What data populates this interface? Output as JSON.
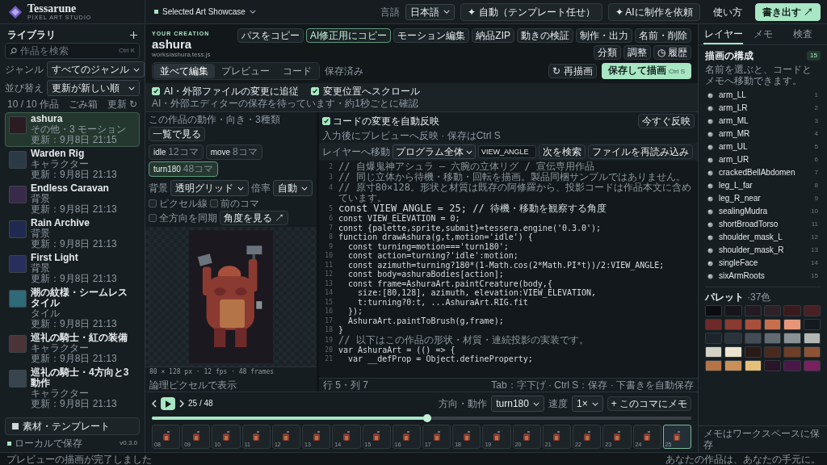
{
  "app": {
    "name": "Tessarune",
    "tagline": "PIXEL ART STUDIO"
  },
  "header": {
    "showcase": "Selected Art Showcase",
    "language_label": "言語",
    "language": "日本語",
    "buttons": [
      {
        "label": "✦ 自動（テンプレート任せ）",
        "kind": "outline"
      },
      {
        "label": "✦ AIに制作を依頼",
        "kind": "outline"
      },
      {
        "label": "使い方",
        "kind": "text"
      },
      {
        "label": "書き出す ↗",
        "kind": "primary"
      }
    ]
  },
  "library": {
    "title": "ライブラリ",
    "search_placeholder": "作品を検索",
    "search_shortcut": "Ctrl K",
    "filters": [
      {
        "label": "ジャンル",
        "value": "すべてのジャンル"
      },
      {
        "label": "並び替え",
        "value": "更新が新しい順"
      }
    ],
    "count": "10 / 10 作品",
    "trash": "ごみ箱",
    "refresh": "更新 ↻",
    "items": [
      {
        "title": "ashura",
        "category": "その他・3 モーション",
        "updated": "更新：9月8日 21:15",
        "selected": true,
        "color": "#2a1c22"
      },
      {
        "title": "Warden Rig",
        "category": "キャラクター",
        "updated": "更新：9月8日 21:13",
        "selected": false,
        "color": "#2c3a46"
      },
      {
        "title": "Endless Caravan",
        "category": "背景",
        "updated": "更新：9月8日 21:13",
        "selected": false,
        "color": "#3a2a4a"
      },
      {
        "title": "Rain Archive",
        "category": "背景",
        "updated": "更新：9月8日 21:13",
        "selected": false,
        "color": "#202a50"
      },
      {
        "title": "First Light",
        "category": "背景",
        "updated": "更新：9月8日 21:13",
        "selected": false,
        "color": "#2a2e5c"
      },
      {
        "title": "潮の紋様・シームレスタイル",
        "category": "タイル",
        "updated": "更新：9月8日 21:13",
        "selected": false,
        "color": "#2e6a78"
      },
      {
        "title": "巡礼の騎士・紅の装備",
        "category": "キャラクター",
        "updated": "更新：9月8日 21:13",
        "selected": false,
        "color": "#4a3438"
      },
      {
        "title": "巡礼の騎士・4方向と3動作",
        "category": "キャラクター",
        "updated": "更新：9月8日 21:13",
        "selected": false,
        "color": "#38444e"
      }
    ],
    "templates_button": "素材・テンプレート",
    "storage": "ローカルで保存",
    "version": "v0.3.0"
  },
  "creation": {
    "eyebrow": "YOUR CREATION",
    "title": "ashura",
    "path": "works/ashura.tess.js",
    "actions": [
      {
        "label": "パスをコピー",
        "kind": "plain"
      },
      {
        "label": "AI修正用にコピー",
        "kind": "accent"
      },
      {
        "label": "モーション編集",
        "kind": "plain"
      },
      {
        "label": "納品ZIP",
        "kind": "plain"
      },
      {
        "label": "動きの検証",
        "kind": "plain"
      },
      {
        "label": "制作・出力",
        "kind": "plain"
      },
      {
        "label": "名前・削除",
        "kind": "plain"
      },
      {
        "label": "分類",
        "kind": "plain"
      },
      {
        "label": "調整",
        "kind": "plain"
      },
      {
        "label": "◷ 履歴",
        "kind": "plain"
      }
    ],
    "view_tabs": [
      {
        "label": "並べて編集",
        "selected": true
      },
      {
        "label": "プレビュー",
        "selected": false
      },
      {
        "label": "コード",
        "selected": false
      }
    ],
    "save_state": "保存済み",
    "redraw": "↻ 再描画",
    "save_button": "保存して描画",
    "save_shortcut": "Ctrl S",
    "options": [
      {
        "label": "AI・外部ファイルの変更に追従",
        "checked": true
      },
      {
        "label": "変更位置へスクロール",
        "checked": true
      }
    ],
    "watch_note": "AI・外部エディターの保存を待っています・約1秒ごとに確認"
  },
  "preview": {
    "heading": "この作品の動作・向き・3種類",
    "overview_button": "一覧で見る",
    "motions": [
      {
        "name": "idle",
        "frames": "12コマ",
        "selected": false
      },
      {
        "name": "move",
        "frames": "8コマ",
        "selected": false
      },
      {
        "name": "turn180",
        "frames": "48コマ",
        "selected": true
      }
    ],
    "background_label": "背景",
    "background": "透明グリッド",
    "zoom_label": "倍率",
    "zoom": "自動",
    "toggles": [
      {
        "label": "ピクセル線",
        "checked": false
      },
      {
        "label": "前のコマ",
        "checked": false
      },
      {
        "label": "全方向を同期",
        "checked": false
      }
    ],
    "angle_button": "角度を見る ↗",
    "info": "80 × 128 px · 12 fps · 48 frames",
    "display_mode": "論理ピクセルで表示"
  },
  "code": {
    "auto_apply": {
      "label": "コードの変更を自動反映",
      "checked": true
    },
    "apply_button": "今すぐ反映",
    "hint": "入力後にプレビューへ反映 · 保存はCtrl S",
    "jump_label": "レイヤーへ移動",
    "jump_target": "プログラム全体",
    "search_value": "VIEW_ANGLE",
    "find_next": "次を検索",
    "reload": "ファイルを再読み込み",
    "lines": [
      {
        "number": "2",
        "text": "// 自爆鬼神アシュラ — 六腕の立体リグ / 宣伝専用作品",
        "kind": "comment"
      },
      {
        "number": "3",
        "text": "// 同じ立体から待機・移動・回転を描画。製品同梱サンプルではありません。",
        "kind": "comment"
      },
      {
        "number": "4",
        "text": "// 原寸80×128。形状と材質は既存の阿修羅から、投影コードは作品本文に含めています。",
        "kind": "comment"
      },
      {
        "number": "5",
        "text": "const VIEW_ANGLE = 25; // 待機・移動を観察する角度",
        "kind": "code"
      },
      {
        "number": "6",
        "text": "const VIEW_ELEVATION = 0;",
        "kind": "code"
      },
      {
        "number": "7",
        "text": "const {palette,sprite,submit}=tessera.engine('0.3.0');",
        "kind": "code"
      },
      {
        "number": "8",
        "text": "function drawAshura(g,t,motion='idle') {",
        "kind": "code"
      },
      {
        "number": "9",
        "text": "  const turning=motion==='turn180';",
        "kind": "code"
      },
      {
        "number": "10",
        "text": "  const action=turning?'idle':motion;",
        "kind": "code"
      },
      {
        "number": "11",
        "text": "  const azimuth=turning?180*(1-Math.cos(2*Math.PI*t))/2:VIEW_ANGLE;",
        "kind": "code"
      },
      {
        "number": "12",
        "text": "  const body=ashuraBodies[action];",
        "kind": "code"
      },
      {
        "number": "13",
        "text": "  const frame=AshuraArt.paintCreature(body,{",
        "kind": "code"
      },
      {
        "number": "14",
        "text": "    size:[80,128], azimuth, elevation:VIEW_ELEVATION,",
        "kind": "code"
      },
      {
        "number": "15",
        "text": "    t:turning?0:t, ...AshuraArt.RIG.fit",
        "kind": "code"
      },
      {
        "number": "16",
        "text": "  });",
        "kind": "code"
      },
      {
        "number": "17",
        "text": "  AshuraArt.paintToBrush(g,frame);",
        "kind": "code"
      },
      {
        "number": "18",
        "text": "}",
        "kind": "code"
      },
      {
        "number": "19",
        "text": "// 以下はこの作品の形状・材質・連続投影の実装です。",
        "kind": "comment"
      },
      {
        "number": "20",
        "text": "var AshuraArt = (() => {",
        "kind": "code"
      },
      {
        "number": "21",
        "text": "  var __defProp = Object.defineProperty;",
        "kind": "code"
      }
    ],
    "cursor": "行 5・列 7",
    "shortcuts": "Tab：字下げ · Ctrl S：保存 · 下書きを自動保存"
  },
  "timeline": {
    "position": "25 / 48",
    "level": 0.51,
    "direction_label": "方向・動作",
    "direction": "turn180",
    "speed_label": "速度",
    "speed": "1×",
    "memo_button": "+ このコマにメモ",
    "frames": [
      {
        "number": "08",
        "selected": false
      },
      {
        "number": "09",
        "selected": false
      },
      {
        "number": "10",
        "selected": false
      },
      {
        "number": "11",
        "selected": false
      },
      {
        "number": "12",
        "selected": false
      },
      {
        "number": "13",
        "selected": false
      },
      {
        "number": "14",
        "selected": false
      },
      {
        "number": "15",
        "selected": false
      },
      {
        "number": "16",
        "selected": false
      },
      {
        "number": "17",
        "selected": false
      },
      {
        "number": "18",
        "selected": false
      },
      {
        "number": "19",
        "selected": false
      },
      {
        "number": "20",
        "selected": false
      },
      {
        "number": "21",
        "selected": false
      },
      {
        "number": "22",
        "selected": false
      },
      {
        "number": "23",
        "selected": false
      },
      {
        "number": "24",
        "selected": false
      },
      {
        "number": "25",
        "selected": true
      }
    ]
  },
  "inspector": {
    "tabs": [
      {
        "label": "レイヤー",
        "selected": true
      },
      {
        "label": "メモ",
        "selected": false
      },
      {
        "label": "検査",
        "selected": false
      }
    ],
    "heading": "描画の構成",
    "count": "15",
    "description": "名前を選ぶと、コードとメモへ移動できます。",
    "layers": [
      {
        "name": "arm_LL",
        "number": "1"
      },
      {
        "name": "arm_LR",
        "number": "2"
      },
      {
        "name": "arm_ML",
        "number": "3"
      },
      {
        "name": "arm_MR",
        "number": "4"
      },
      {
        "name": "arm_UL",
        "number": "5"
      },
      {
        "name": "arm_UR",
        "number": "6"
      },
      {
        "name": "crackedBellAbdomen",
        "number": "7"
      },
      {
        "name": "leg_L_far",
        "number": "8"
      },
      {
        "name": "leg_R_near",
        "number": "9"
      },
      {
        "name": "sealingMudra",
        "number": "10"
      },
      {
        "name": "shortBroadTorso",
        "number": "11"
      },
      {
        "name": "shoulder_mask_L",
        "number": "12"
      },
      {
        "name": "shoulder_mask_R",
        "number": "13"
      },
      {
        "name": "singleFace",
        "number": "14"
      },
      {
        "name": "sixArmRoots",
        "number": "15"
      }
    ],
    "palette": {
      "title": "パレット",
      "count": "·37色",
      "colors": [
        {
          "color": "#0b0d10"
        },
        {
          "color": "#15151b"
        },
        {
          "color": "#241a22"
        },
        {
          "color": "#2e2228"
        },
        {
          "color": "#3a1a1c"
        },
        {
          "color": "#4a2024"
        },
        {
          "color": "#6e2a28"
        },
        {
          "color": "#8a3a30"
        },
        {
          "color": "#a8503c"
        },
        {
          "color": "#c8704e"
        },
        {
          "color": "#e8967a"
        },
        {
          "color": "#141a20"
        },
        {
          "color": "#1e242c"
        },
        {
          "color": "#2a323a"
        },
        {
          "color": "#434c55"
        },
        {
          "color": "#626b72"
        },
        {
          "color": "#8a9296"
        },
        {
          "color": "#b4b8b4"
        },
        {
          "color": "#d4d2c4"
        },
        {
          "color": "#ece4cc"
        },
        {
          "color": "#2a1a16"
        },
        {
          "color": "#4a2a1e"
        },
        {
          "color": "#6e3e26"
        },
        {
          "color": "#8e5234"
        },
        {
          "color": "#b47448"
        },
        {
          "color": "#c89058"
        },
        {
          "color": "#e4c078"
        },
        {
          "color": "#2a1428"
        },
        {
          "color": "#4a1848"
        },
        {
          "color": "#7a2060"
        }
      ]
    },
    "footer": "メモはワークスペースに保存"
  },
  "status_bar": {
    "message": "プレビューの描画が完了しました",
    "tagline": "あなたの作品は、あなたの手元に。"
  }
}
